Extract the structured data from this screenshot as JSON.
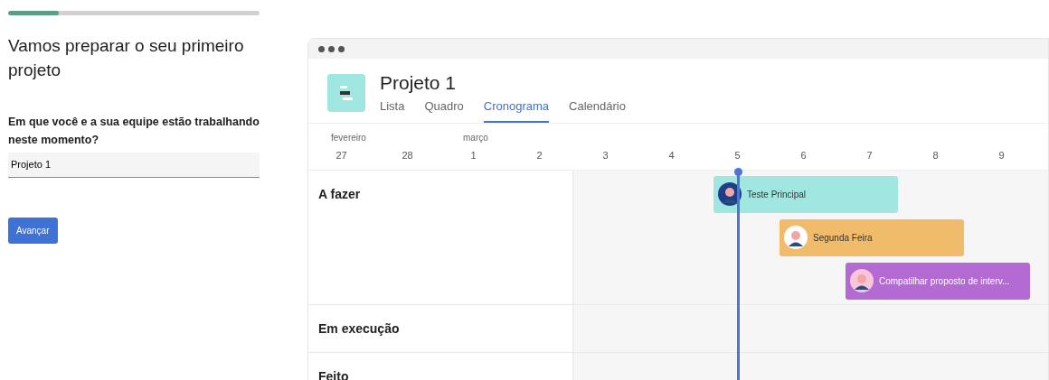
{
  "onboarding": {
    "progress": {
      "level": 0.2
    },
    "heading": "Vamos preparar o seu primeiro projeto",
    "question": "Em que você e a sua equipe estão trabalhando neste momento?",
    "answer": {
      "value": "Projeto 1"
    },
    "next_button": "Avançar"
  },
  "preview": {
    "project_title": "Projeto 1",
    "tabs": [
      {
        "label": "Lista",
        "selected": false
      },
      {
        "label": "Quadro",
        "selected": false
      },
      {
        "label": "Cronograma",
        "selected": true
      },
      {
        "label": "Calendário",
        "selected": false
      }
    ],
    "months": [
      "fevereiro",
      "março"
    ],
    "days": [
      "27",
      "28",
      "1",
      "2",
      "3",
      "4",
      "5",
      "6",
      "7",
      "8",
      "9"
    ],
    "lanes": [
      {
        "label": "A fazer"
      },
      {
        "label": "Em execução"
      },
      {
        "label": "Feito"
      }
    ],
    "tasks": [
      {
        "title": "Teste Principal",
        "color": "#a0e7e2"
      },
      {
        "title": "Segunda Feira",
        "color": "#f0bb6a"
      },
      {
        "title": "Compatilhar proposto de interv...",
        "color": "#b36bd3"
      }
    ]
  }
}
